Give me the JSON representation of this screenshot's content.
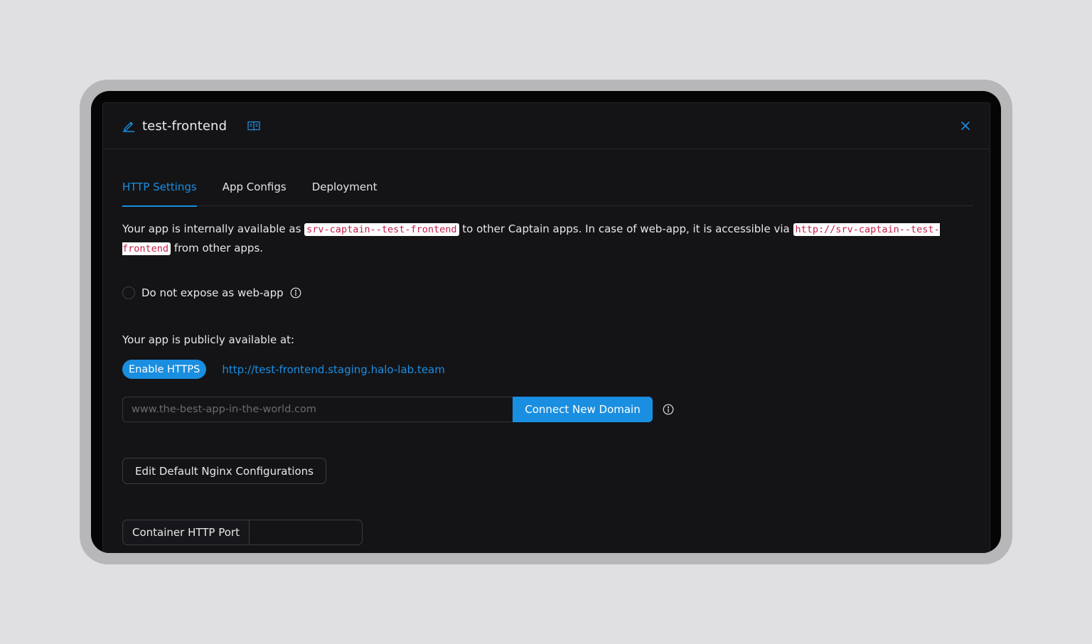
{
  "header": {
    "app_name": "test-frontend"
  },
  "tabs": [
    {
      "label": "HTTP Settings",
      "active": true
    },
    {
      "label": "App Configs",
      "active": false
    },
    {
      "label": "Deployment",
      "active": false
    }
  ],
  "intro": {
    "part1": "Your app is internally available as",
    "internal_name": "srv-captain--test-frontend",
    "part2": "to other Captain apps. In case of web-app, it is accessible via",
    "internal_url": "http://srv-captain--test-frontend",
    "part3": "from other apps."
  },
  "expose": {
    "label": "Do not expose as web-app",
    "checked": false
  },
  "public": {
    "label": "Your app is publicly available at:",
    "enable_https_label": "Enable HTTPS",
    "url": "http://test-frontend.staging.halo-lab.team"
  },
  "domain": {
    "placeholder": "www.the-best-app-in-the-world.com",
    "value": "",
    "connect_label": "Connect New Domain"
  },
  "nginx": {
    "button_label": "Edit Default Nginx Configurations"
  },
  "port": {
    "label": "Container HTTP Port",
    "value": ""
  },
  "colors": {
    "accent": "#1a8ee0",
    "background": "#141417",
    "code_text": "#c41d4b"
  }
}
